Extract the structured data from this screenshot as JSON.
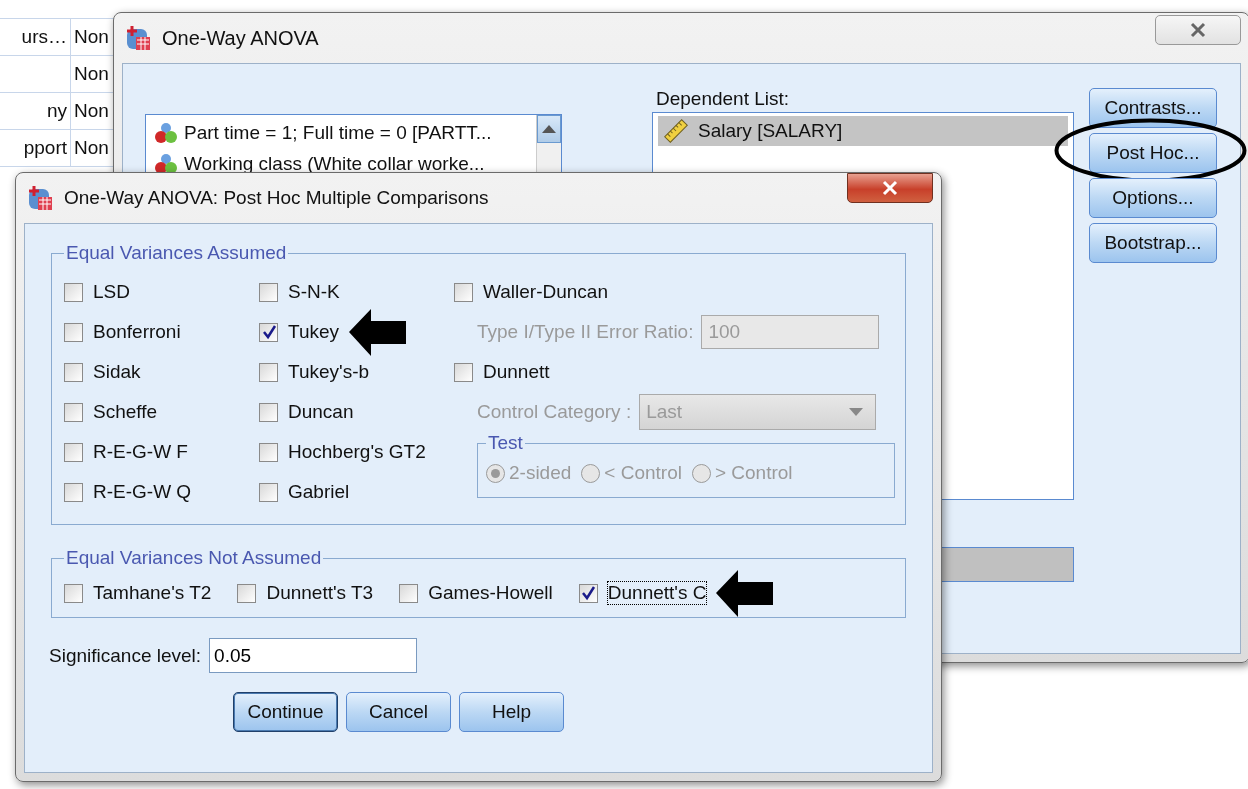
{
  "spreadsheet": {
    "rows": [
      {
        "column_1": "urs…",
        "column_2": "Non"
      },
      {
        "column_2": "Non"
      },
      {
        "column_1": "ny",
        "column_2": "Non"
      },
      {
        "column_1": "pport",
        "column_2": "Non"
      }
    ]
  },
  "main_window": {
    "title": "One-Way ANOVA",
    "variable_list": [
      {
        "label": "Part time = 1; Full time = 0 [PARTT..."
      },
      {
        "label": "Working class (White collar worke..."
      }
    ],
    "dependent_list": {
      "label": "Dependent List:",
      "items": [
        {
          "label": "Salary [SALARY]",
          "selected": true
        }
      ]
    },
    "buttons": [
      {
        "label": "Contrasts...",
        "circled": false
      },
      {
        "label": "Post Hoc...",
        "circled": true
      },
      {
        "label": "Options...",
        "circled": false
      },
      {
        "label": "Bootstrap...",
        "circled": false
      }
    ]
  },
  "post_hoc_dialog": {
    "title": "One-Way ANOVA: Post Hoc Multiple Comparisons",
    "equal_variances_assumed": {
      "legend": "Equal Variances Assumed",
      "column_1": [
        {
          "label": "LSD",
          "checked": false,
          "pointed": false
        },
        {
          "label": "Bonferroni",
          "checked": false,
          "pointed": false
        },
        {
          "label": "Sidak",
          "checked": false,
          "pointed": false
        },
        {
          "label": "Scheffe",
          "checked": false,
          "pointed": false
        },
        {
          "label": "R-E-G-W F",
          "checked": false,
          "pointed": false
        },
        {
          "label": "R-E-G-W Q",
          "checked": false,
          "pointed": false
        }
      ],
      "column_2": [
        {
          "label": "S-N-K",
          "checked": false,
          "pointed": false
        },
        {
          "label": "Tukey",
          "checked": true,
          "pointed": true
        },
        {
          "label": "Tukey's-b",
          "checked": false,
          "pointed": false
        },
        {
          "label": "Duncan",
          "checked": false,
          "pointed": false
        },
        {
          "label": "Hochberg's GT2",
          "checked": false,
          "pointed": false
        },
        {
          "label": "Gabriel",
          "checked": false,
          "pointed": false
        }
      ],
      "column_3": [
        {
          "kind": "checkbox",
          "label": "Waller-Duncan",
          "checked": false
        },
        {
          "kind": "field",
          "label": "Type I/Type II Error Ratio:",
          "value": "100",
          "disabled": true
        },
        {
          "kind": "checkbox",
          "label": "Dunnett",
          "checked": false
        },
        {
          "kind": "dropdown",
          "label": "Control Category :",
          "value": "Last",
          "disabled": true
        },
        {
          "kind": "radio_group",
          "legend": "Test",
          "disabled": true,
          "options": [
            {
              "label": "2-sided",
              "selected": true
            },
            {
              "label": "< Control",
              "selected": false
            },
            {
              "label": "> Control",
              "selected": false
            }
          ]
        }
      ]
    },
    "equal_variances_not_assumed": {
      "legend": "Equal Variances Not Assumed",
      "options": [
        {
          "label": "Tamhane's T2",
          "checked": false,
          "focused": false,
          "pointed": false
        },
        {
          "label": "Dunnett's T3",
          "checked": false,
          "focused": false,
          "pointed": false
        },
        {
          "label": "Games-Howell",
          "checked": false,
          "focused": false,
          "pointed": false
        },
        {
          "label": "Dunnett's C",
          "checked": true,
          "focused": true,
          "pointed": true
        }
      ]
    },
    "significance_level": {
      "label": "Significance level:",
      "value": "0.05"
    },
    "buttons": [
      {
        "label": "Continue",
        "default": true
      },
      {
        "label": "Cancel",
        "default": false
      },
      {
        "label": "Help",
        "default": false
      }
    ]
  }
}
